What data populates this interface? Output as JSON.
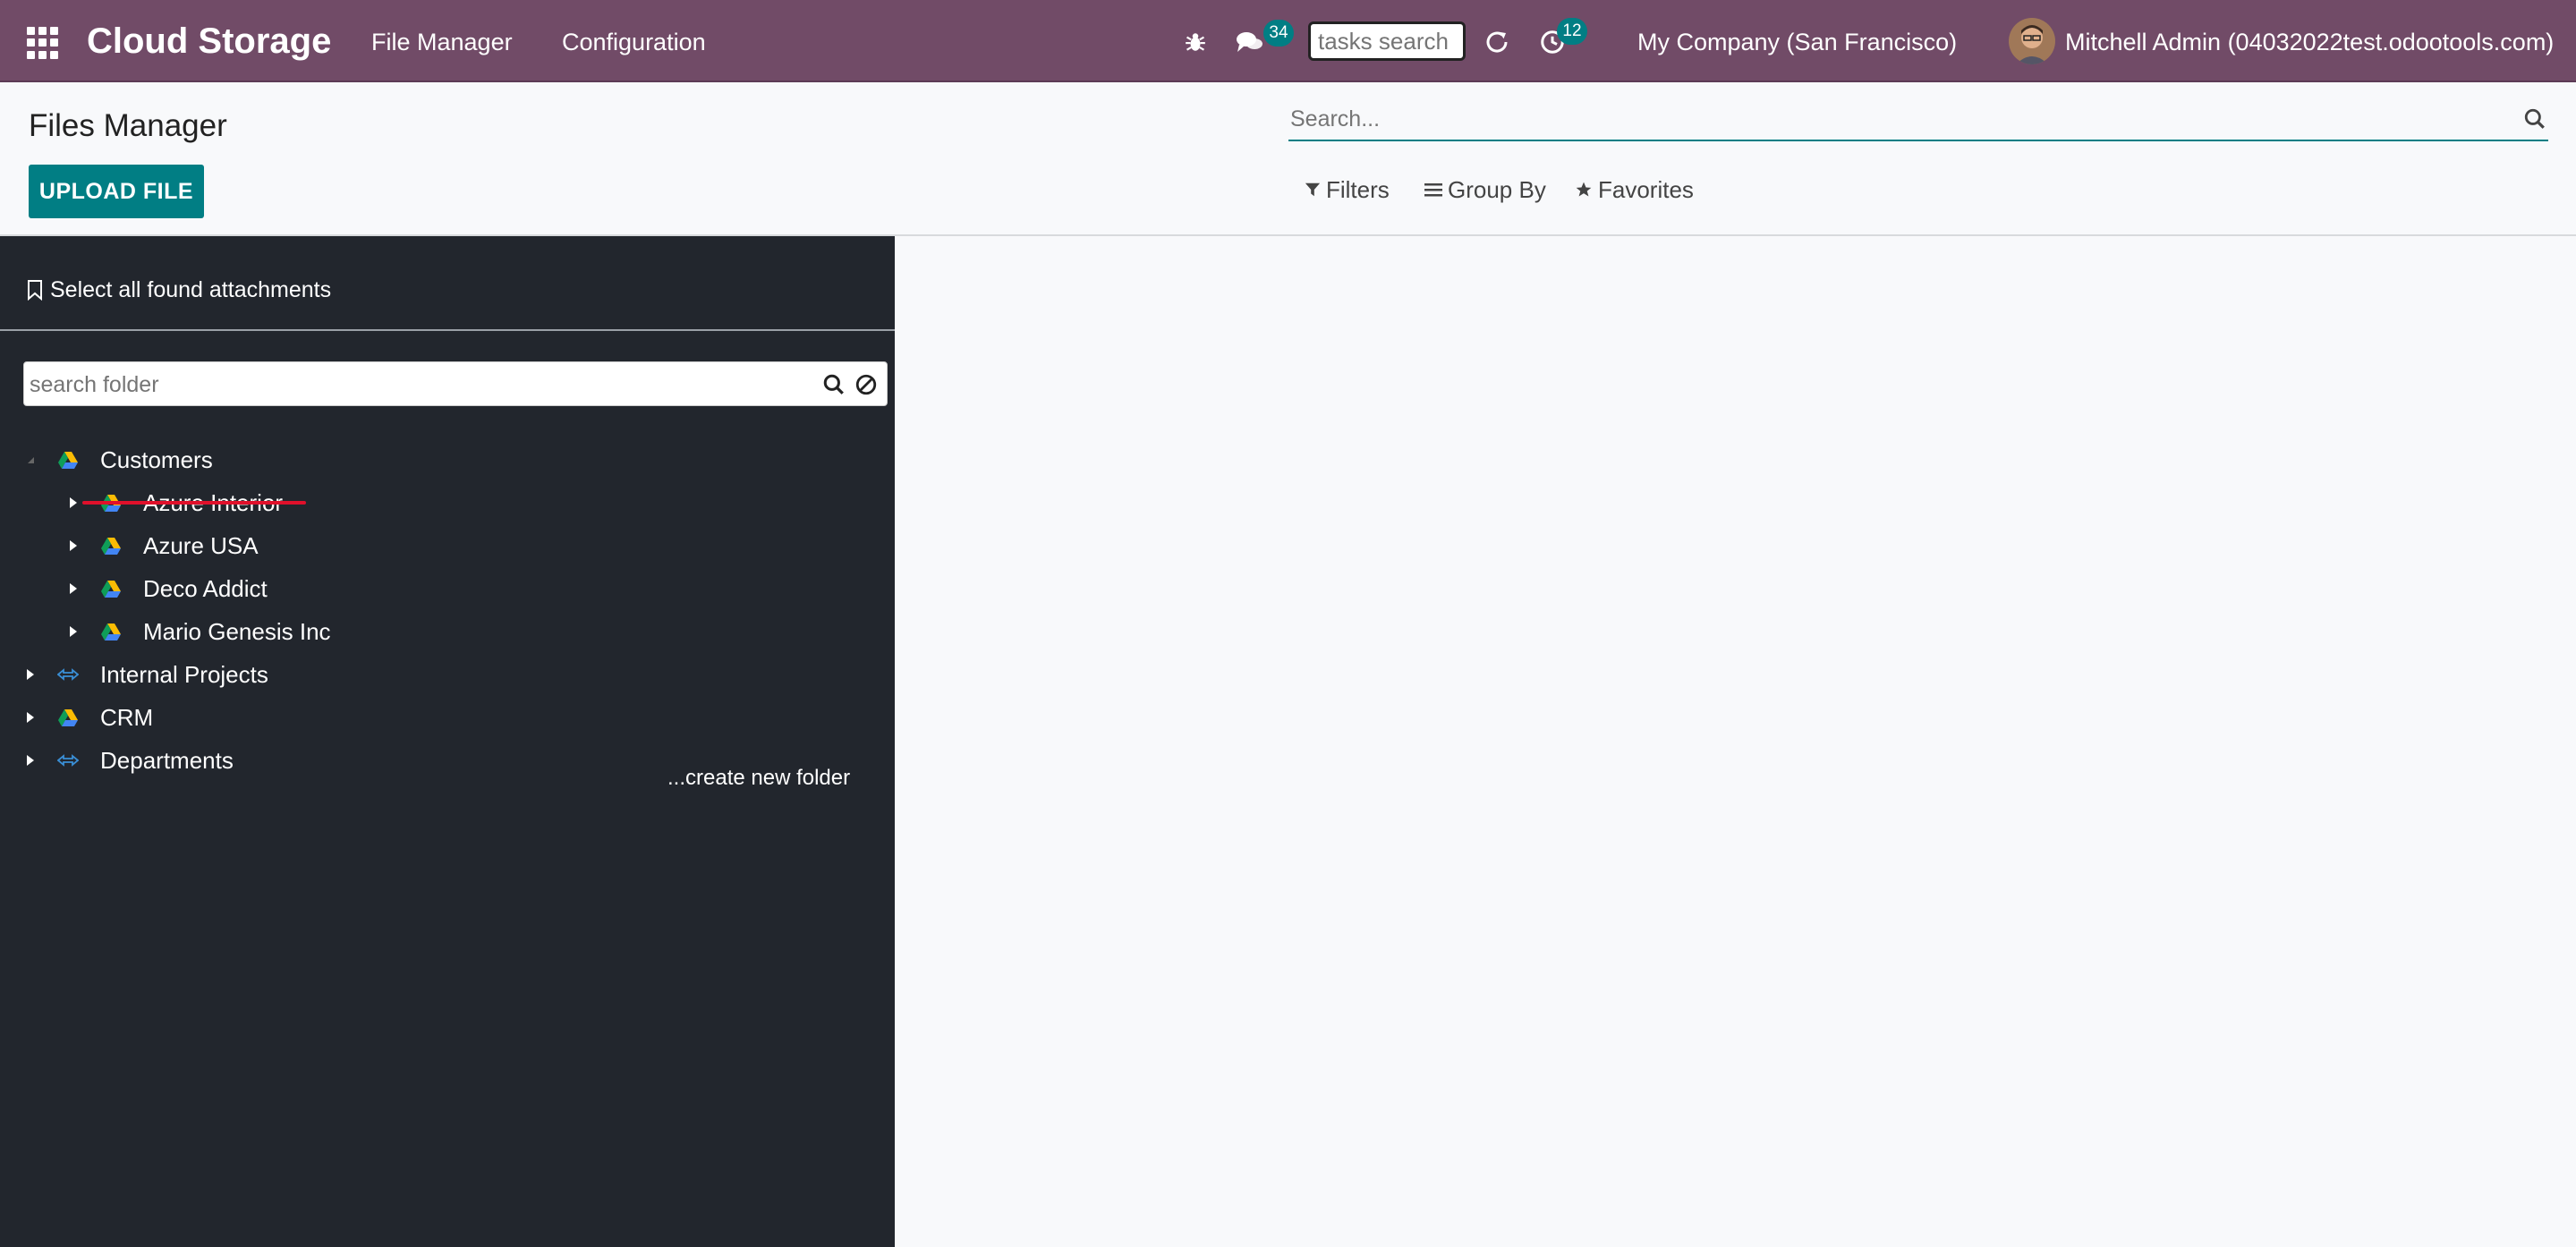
{
  "navbar": {
    "brand": "Cloud Storage",
    "menu": [
      "File Manager",
      "Configuration"
    ],
    "messages_count": "34",
    "tasks_search_placeholder": "tasks search",
    "activities_count": "12",
    "company": "My Company (San Francisco)",
    "user": "Mitchell Admin (04032022test.odootools.com)"
  },
  "control_panel": {
    "title": "Files Manager",
    "upload_label": "UPLOAD FILE",
    "search_placeholder": "Search...",
    "filters_label": "Filters",
    "group_by_label": "Group By",
    "favorites_label": "Favorites"
  },
  "sidebar": {
    "select_all_label": "Select all found attachments",
    "folder_search_placeholder": "search folder",
    "tree": [
      {
        "label": "Customers",
        "icon": "google-drive-icon",
        "expanded": true,
        "level": 0
      },
      {
        "label": "Azure Interior",
        "icon": "google-drive-icon",
        "expanded": false,
        "level": 1,
        "highlighted": true
      },
      {
        "label": "Azure USA",
        "icon": "google-drive-icon",
        "expanded": false,
        "level": 1
      },
      {
        "label": "Deco Addict",
        "icon": "google-drive-icon",
        "expanded": false,
        "level": 1
      },
      {
        "label": "Mario Genesis Inc",
        "icon": "google-drive-icon",
        "expanded": false,
        "level": 1
      },
      {
        "label": "Internal Projects",
        "icon": "sync-folder-icon",
        "expanded": false,
        "level": 0
      },
      {
        "label": "CRM",
        "icon": "google-drive-icon",
        "expanded": false,
        "level": 0
      },
      {
        "label": "Departments",
        "icon": "sync-folder-icon",
        "expanded": false,
        "level": 0
      }
    ],
    "create_folder_label": "...create new folder"
  },
  "colors": {
    "navbar": "#714b67",
    "accent": "#017e84",
    "sidebar_bg": "#22262d",
    "highlight_underline": "#e0102b"
  }
}
